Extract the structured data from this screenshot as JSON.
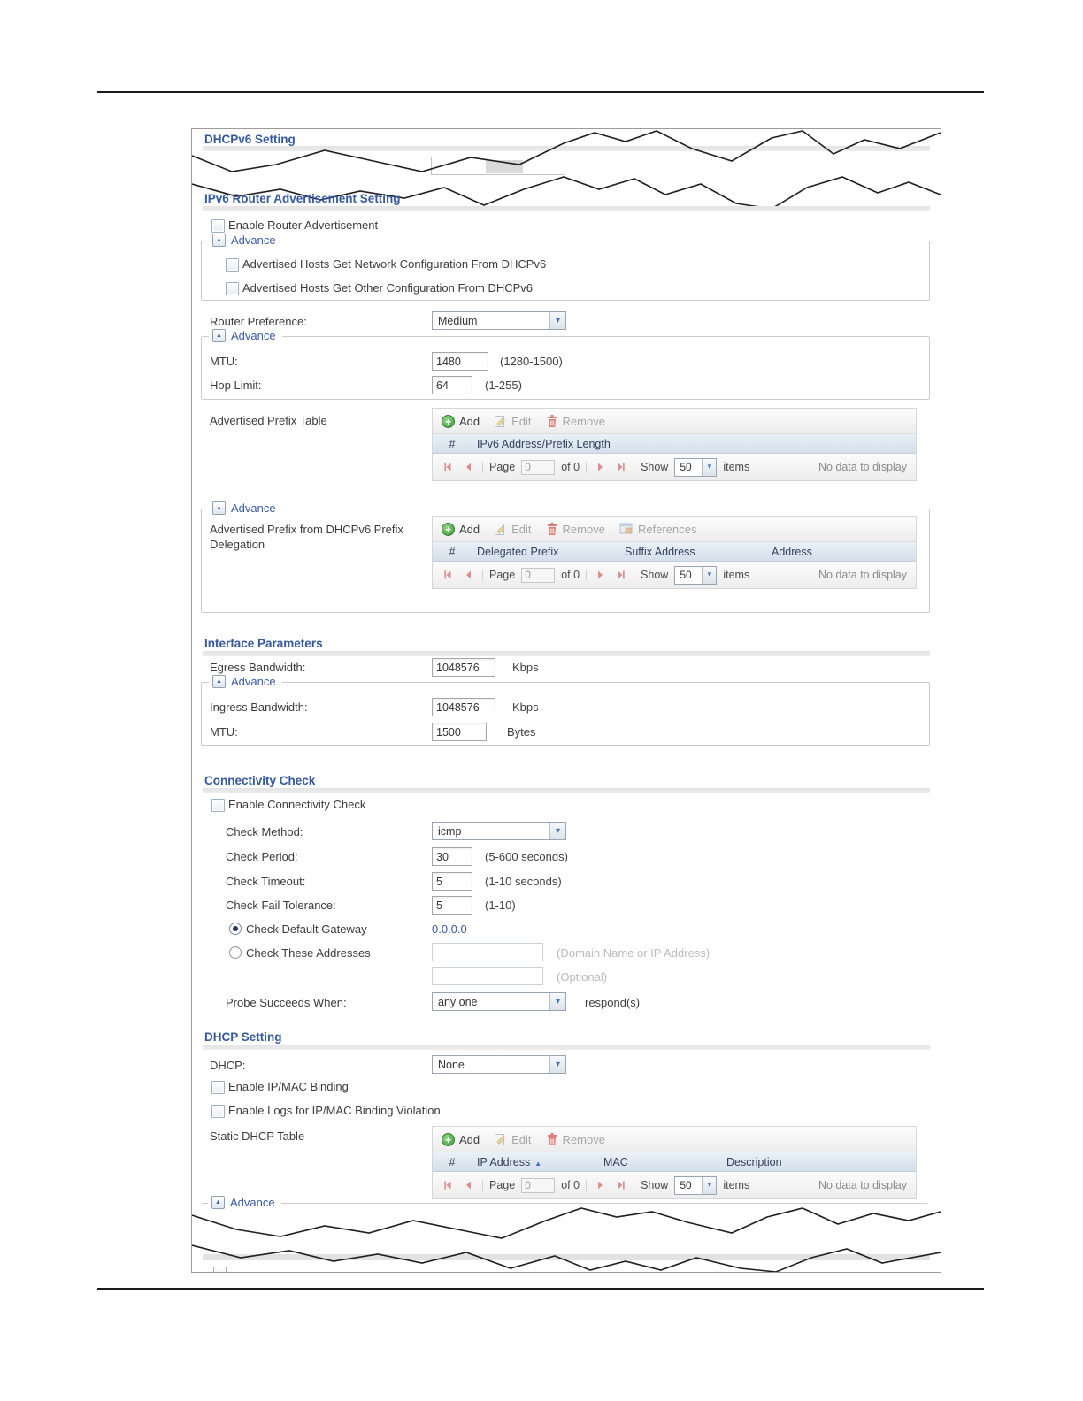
{
  "advance": {
    "label": "Advance"
  },
  "glyphs": {
    "triangle_up": "▲",
    "chevron_down": "▾",
    "plus": "+",
    "sort_asc": "▲"
  },
  "colors": {
    "heading_blue": "#35599e",
    "add_green": "#3d9e3c",
    "remove_red": "#d97b74",
    "pager_arrow": "#d9908e",
    "link_blue": "#35599e"
  },
  "toolbar": {
    "add": "Add",
    "edit": "Edit",
    "remove": "Remove",
    "references": "References"
  },
  "pager": {
    "page_label": "Page",
    "page_value": "0",
    "of_label": "of 0",
    "show_label": "Show",
    "show_value": "50",
    "items_label": "items",
    "empty": "No data to display"
  },
  "dhcpv6": {
    "heading": "DHCPv6 Setting"
  },
  "ra": {
    "heading": "IPv6 Router Advertisement Setting",
    "enable": "Enable Router Advertisement",
    "host_net": "Advertised Hosts Get Network Configuration From DHCPv6",
    "host_other": "Advertised Hosts Get Other Configuration From DHCPv6",
    "router_pref_label": "Router Preference:",
    "router_pref_value": "Medium",
    "mtu_label": "MTU:",
    "mtu_value": "1480",
    "mtu_hint": "(1280-1500)",
    "hop_label": "Hop Limit:",
    "hop_value": "64",
    "hop_hint": "(1-255)",
    "prefix_table_label": "Advertised Prefix Table",
    "prefix_cols": [
      "#",
      "IPv6 Address/Prefix Length"
    ],
    "delegation_label": "Advertised Prefix from DHCPv6 Prefix Delegation",
    "delegation_cols": [
      "#",
      "Delegated Prefix",
      "Suffix Address",
      "Address"
    ]
  },
  "iface": {
    "heading": "Interface Parameters",
    "egress_label": "Egress Bandwidth:",
    "egress_value": "1048576",
    "egress_unit": "Kbps",
    "ingress_label": "Ingress Bandwidth:",
    "ingress_value": "1048576",
    "ingress_unit": "Kbps",
    "mtu_label": "MTU:",
    "mtu_value": "1500",
    "mtu_unit": "Bytes"
  },
  "conn": {
    "heading": "Connectivity Check",
    "enable": "Enable Connectivity Check",
    "method_label": "Check Method:",
    "method_value": "icmp",
    "period_label": "Check Period:",
    "period_value": "30",
    "period_hint": "(5-600 seconds)",
    "timeout_label": "Check Timeout:",
    "timeout_value": "5",
    "timeout_hint": "(1-10 seconds)",
    "fail_label": "Check Fail Tolerance:",
    "fail_value": "5",
    "fail_hint": "(1-10)",
    "gw_label": "Check Default Gateway",
    "gw_value": "0.0.0.0",
    "addr_label": "Check These Addresses",
    "addr_hint1": "(Domain Name or IP Address)",
    "addr_hint2": "(Optional)",
    "probe_label": "Probe Succeeds When:",
    "probe_value": "any one",
    "probe_suffix": "respond(s)"
  },
  "dhcp": {
    "heading": "DHCP Setting",
    "dhcp_label": "DHCP:",
    "dhcp_value": "None",
    "binding": "Enable IP/MAC Binding",
    "logs": "Enable Logs for IP/MAC Binding Violation",
    "static_label": "Static DHCP Table",
    "static_cols": [
      "#",
      "IP Address",
      "MAC",
      "Description"
    ]
  }
}
